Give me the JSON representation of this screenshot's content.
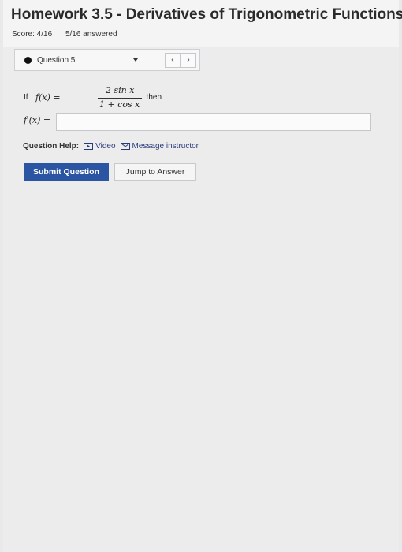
{
  "header": {
    "title": "Homework 3.5 - Derivatives of Trigonometric Functions",
    "score": "Score: 4/16",
    "answered": "5/16 answered"
  },
  "question_nav": {
    "current": "Question 5",
    "prev_symbol": "‹",
    "next_symbol": "›"
  },
  "problem": {
    "intro": "If",
    "function_lhs": "f(x) =",
    "numerator": "2 sin x",
    "denominator": "1 + cos x",
    "then": ", then",
    "derivative_lhs": "f′(x) ="
  },
  "answer": {
    "value": ""
  },
  "help": {
    "label": "Question Help:",
    "video": "Video",
    "message": "Message instructor"
  },
  "actions": {
    "submit": "Submit Question",
    "jump": "Jump to Answer"
  },
  "colors": {
    "primary": "#2b55a2",
    "link": "#2a3b7a"
  },
  "icons": {
    "video": "video-icon",
    "message": "envelope-icon",
    "caret": "chevron-down-icon"
  }
}
